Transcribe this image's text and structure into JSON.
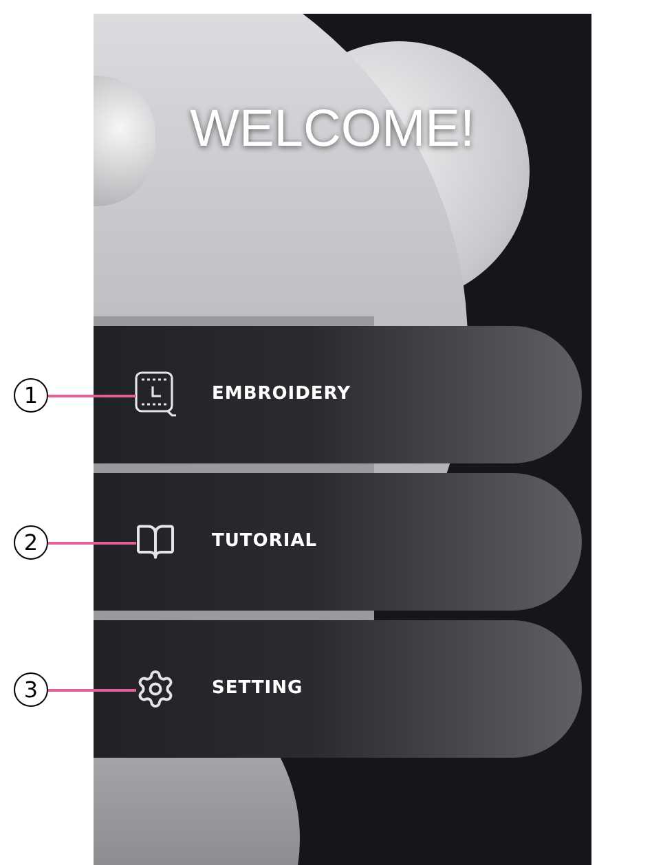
{
  "screen": {
    "title": "WELCOME!",
    "menu": [
      {
        "kind": "embroidery",
        "label": "EMBROIDERY",
        "callout": "1"
      },
      {
        "kind": "tutorial",
        "label": "TUTORIAL",
        "callout": "2"
      },
      {
        "kind": "setting",
        "label": "SETTING",
        "callout": "3"
      }
    ]
  }
}
